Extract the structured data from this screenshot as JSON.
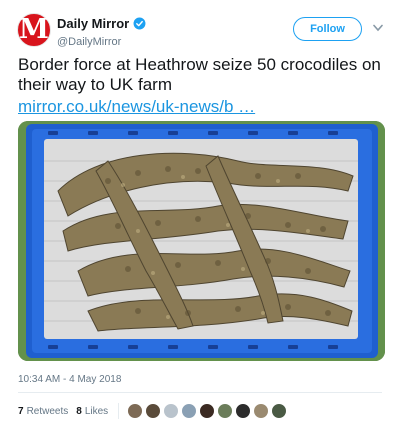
{
  "header": {
    "avatar_letter": "M",
    "display_name": "Daily Mirror",
    "handle": "@DailyMirror",
    "verified_icon": "verified-badge-icon",
    "follow_label": "Follow",
    "menu_icon": "chevron-down-icon"
  },
  "tweet": {
    "text": "Border force at Heathrow seize 50 crocodiles on their way to UK farm",
    "link": "mirror.co.uk/news/uk-news/b …"
  },
  "media": {
    "image_icon": "crocodiles-in-crate-photo"
  },
  "meta": {
    "timestamp": "10:34 AM - 4 May 2018",
    "retweets_count": "7",
    "retweets_label": "Retweets",
    "likes_count": "8",
    "likes_label": "Likes"
  },
  "liker_colors": [
    "#7d6a55",
    "#5a4b3a",
    "#b9c3cc",
    "#8aa0b4",
    "#3b2a22",
    "#6b7d5a",
    "#2c2c2c",
    "#9a8a70",
    "#4a5a44"
  ],
  "colors": {
    "accent": "#1da1f2",
    "link": "#1b95e0",
    "brand_red": "#d8141c",
    "crate_blue": "#1f5fcf"
  }
}
